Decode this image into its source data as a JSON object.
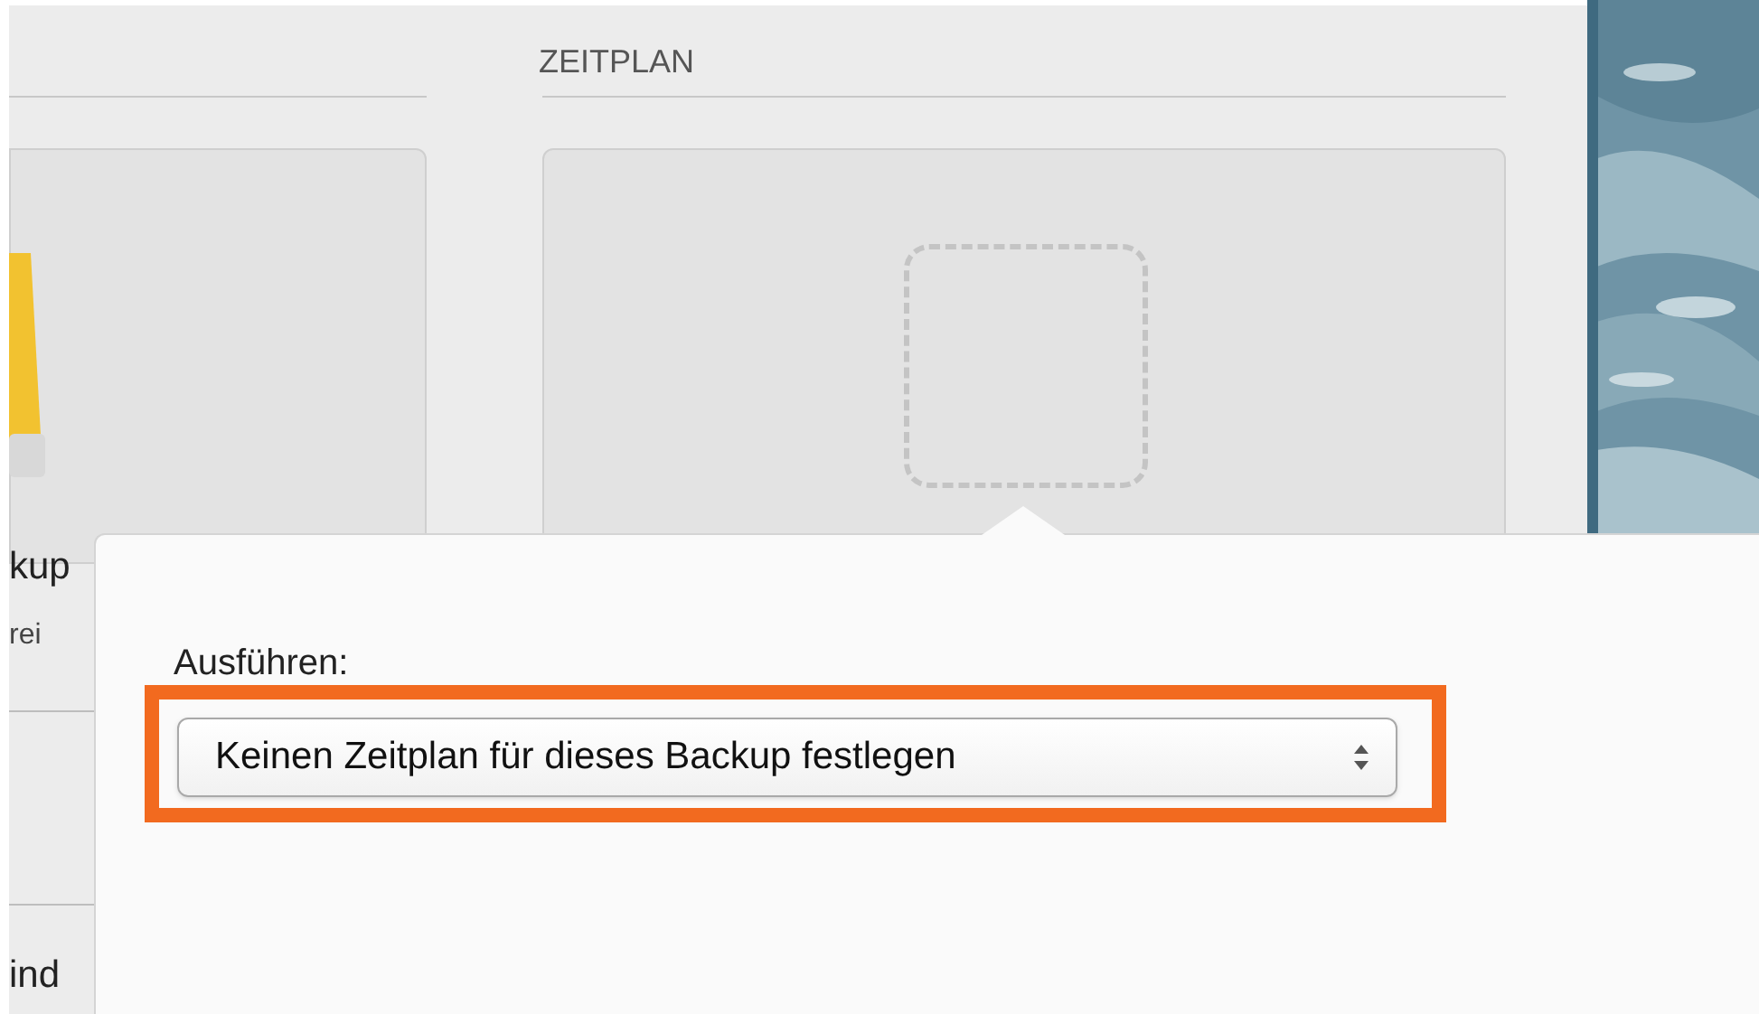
{
  "left_panel": {
    "title_fragment": "kup",
    "subtitle_fragment": "rei",
    "bottom_fragment": "ind"
  },
  "schedule_panel": {
    "heading": "ZEITPLAN"
  },
  "popover": {
    "label": "Ausführen:",
    "select": {
      "value": "Keinen Zeitplan für dieses Backup festlegen",
      "highlighted": true
    }
  }
}
